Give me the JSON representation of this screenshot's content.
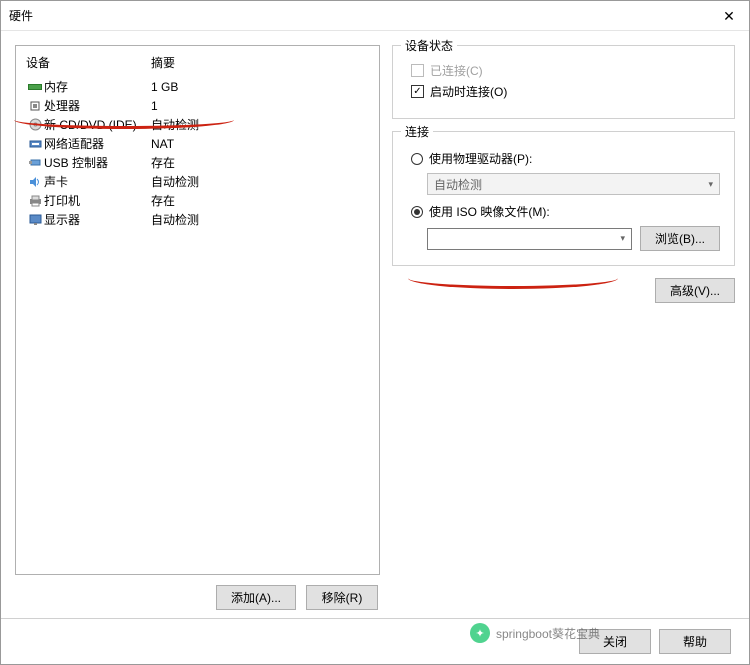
{
  "title": "硬件",
  "headers": {
    "device": "设备",
    "summary": "摘要"
  },
  "hw": [
    {
      "icon": "memory-icon",
      "name": "内存",
      "summary": "1 GB"
    },
    {
      "icon": "cpu-icon",
      "name": "处理器",
      "summary": "1"
    },
    {
      "icon": "cd-icon",
      "name": "新 CD/DVD (IDE)",
      "summary": "自动检测"
    },
    {
      "icon": "net-icon",
      "name": "网络适配器",
      "summary": "NAT"
    },
    {
      "icon": "usb-icon",
      "name": "USB 控制器",
      "summary": "存在"
    },
    {
      "icon": "sound-icon",
      "name": "声卡",
      "summary": "自动检测"
    },
    {
      "icon": "printer-icon",
      "name": "打印机",
      "summary": "存在"
    },
    {
      "icon": "display-icon",
      "name": "显示器",
      "summary": "自动检测"
    }
  ],
  "left_btn": {
    "add": "添加(A)...",
    "remove": "移除(R)"
  },
  "status": {
    "title": "设备状态",
    "connected": "已连接(C)",
    "connect_on": "启动时连接(O)"
  },
  "conn": {
    "title": "连接",
    "physical": "使用物理驱动器(P):",
    "auto": "自动检测",
    "iso": "使用 ISO 映像文件(M):",
    "iso_value": "",
    "browse": "浏览(B)..."
  },
  "advanced": "高级(V)...",
  "footer": {
    "close": "关闭",
    "help": "帮助"
  },
  "watermark": "springboot葵花宝典"
}
